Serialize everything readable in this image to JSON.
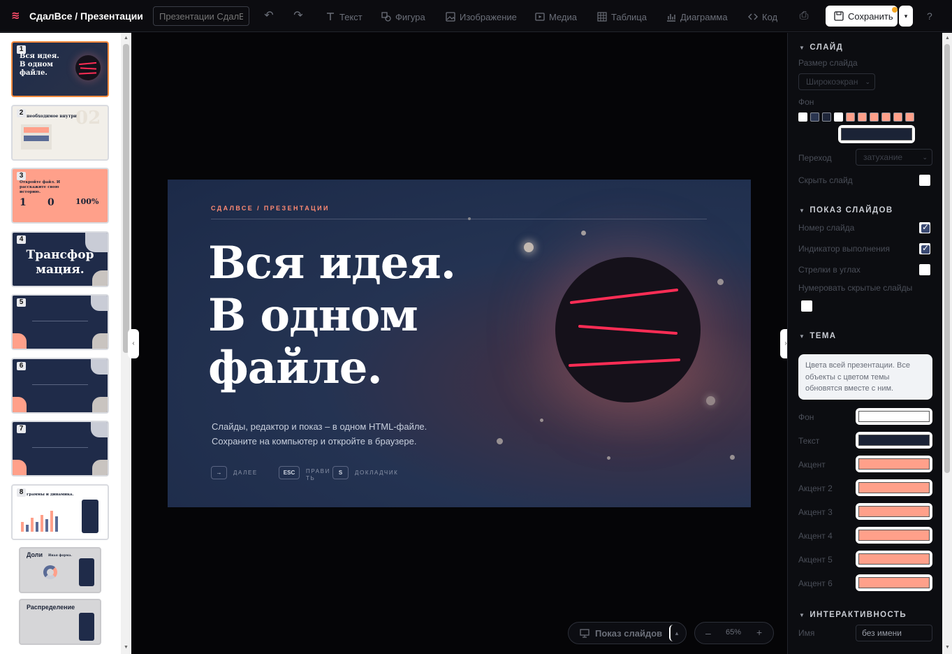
{
  "app": {
    "logo_glyph": "≋",
    "title": "СдалВсе / Презентации",
    "name_placeholder": "Презентации СдалВсе"
  },
  "toolbar": {
    "undo_glyph": "↶",
    "redo_glyph": "↷",
    "tools": [
      {
        "label": "Текст",
        "icon": "text-icon"
      },
      {
        "label": "Фигура",
        "icon": "shape-icon"
      },
      {
        "label": "Изображение",
        "icon": "image-icon"
      },
      {
        "label": "Медиа",
        "icon": "media-icon"
      },
      {
        "label": "Таблица",
        "icon": "table-icon"
      },
      {
        "label": "Диаграмма",
        "icon": "chart-icon"
      },
      {
        "label": "Код",
        "icon": "code-icon"
      }
    ],
    "print_glyph": "⎙",
    "save_label": "Сохранить",
    "save_caret": "▾",
    "help_glyph": "?"
  },
  "slides": [
    {
      "num": "1",
      "theme": "dark",
      "title": "Вся идея. В одном файле.",
      "active": true
    },
    {
      "num": "2",
      "theme": "light",
      "title": "необходимое внутри."
    },
    {
      "num": "3",
      "theme": "coral",
      "title": "Откройте файл. И расскажите свою историю.",
      "stats": [
        "1",
        "0",
        "100%"
      ]
    },
    {
      "num": "4",
      "theme": "navy",
      "title": "Трансфор мация."
    },
    {
      "num": "5",
      "theme": "navy-formula"
    },
    {
      "num": "6",
      "theme": "navy-formula"
    },
    {
      "num": "7",
      "theme": "navy-formula"
    },
    {
      "num": "8",
      "theme": "chart",
      "title": "граммы и динамика."
    },
    {
      "num": "",
      "theme": "donut",
      "title": "Доли",
      "subtitle": "Иная форма."
    },
    {
      "num": "",
      "theme": "dist",
      "title": "Распределение"
    }
  ],
  "slide": {
    "kicker": "СДАЛВСЕ / ПРЕЗЕНТАЦИИ",
    "title_lines": [
      "Вся идея.",
      "В одном",
      "файле."
    ],
    "subtitle_lines": [
      "Слайды, редактор и показ – в одном HTML-файле.",
      "Сохраните на компьютер и откройте в браузере."
    ],
    "keys": [
      {
        "key": "→",
        "label": "ДАЛЕЕ"
      },
      {
        "key": "ESC",
        "label": "ПРАВИ\nТЬ"
      },
      {
        "key": "S",
        "label": "ДОКЛАДЧИК"
      }
    ]
  },
  "bottom": {
    "show_label": "Показ слайдов",
    "show_caret": "▴",
    "zoom_minus": "–",
    "zoom_value": "65%",
    "zoom_plus": "+"
  },
  "panel": {
    "slide_section": "СЛАЙД",
    "size_label": "Размер слайда",
    "size_value": "Широкоэкран",
    "bg_label": "Фон",
    "bg_swatches": [
      "#ffffff",
      "#2a3550",
      "#1e2538",
      "#ffffff",
      "#ffa08a",
      "#ffa08a",
      "#ffa08a",
      "#ffa08a",
      "#ffa08a",
      "#ffa08a"
    ],
    "bg_selected": "#1b2336",
    "transition_label": "Переход",
    "transition_value": "затухание",
    "hide_label": "Скрыть слайд",
    "show_section": "ПОКАЗ СЛАЙДОВ",
    "slide_number_label": "Номер слайда",
    "progress_label": "Индикатор выполнения",
    "arrows_label": "Стрелки в углах",
    "number_hidden_label": "Нумеровать скрытые слайды",
    "theme_section": "ТЕМА",
    "theme_info": "Цвета всей презентации. Все объекты с цветом темы обновятся вместе с ним.",
    "theme_colors": [
      {
        "label": "Фон",
        "color": "#ffffff"
      },
      {
        "label": "Текст",
        "color": "#1b2336"
      },
      {
        "label": "Акцент",
        "color": "#ffa08a"
      },
      {
        "label": "Акцент 2",
        "color": "#ffa08a"
      },
      {
        "label": "Акцент 3",
        "color": "#ffa08a"
      },
      {
        "label": "Акцент 4",
        "color": "#ffa08a"
      },
      {
        "label": "Акцент 5",
        "color": "#ffa08a"
      },
      {
        "label": "Акцент 6",
        "color": "#ffa08a"
      }
    ],
    "inter_section": "ИНТЕРАКТИВНОСТЬ",
    "name_label": "Имя",
    "name_placeholder": "без имени"
  },
  "colors": {
    "accent": "#ff8a73",
    "active_thumb": "#ff8a3d",
    "line_red": "#ff2d55"
  }
}
